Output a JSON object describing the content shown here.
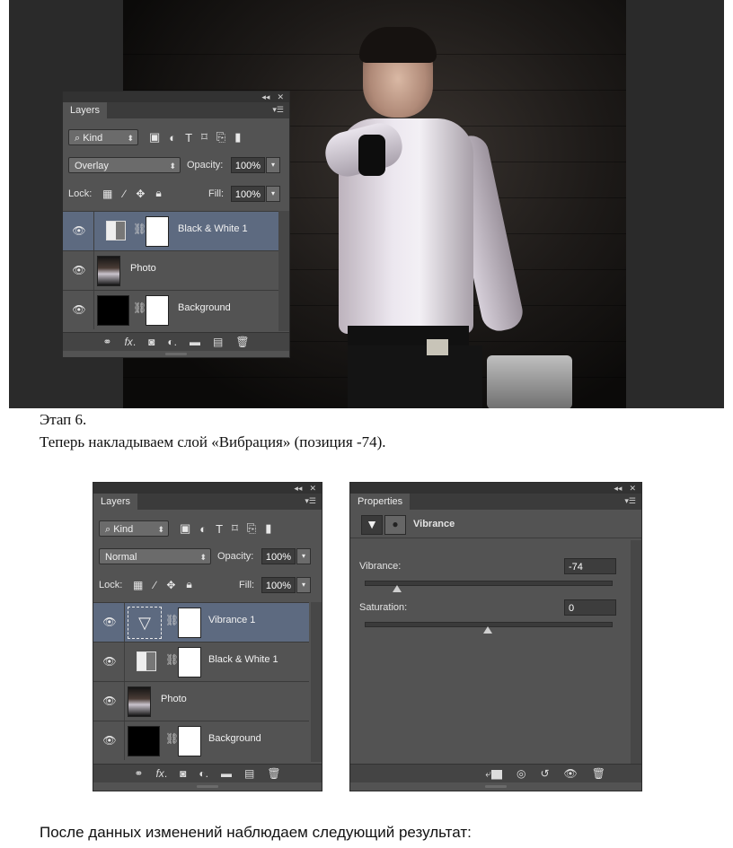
{
  "layers_panel_top": {
    "tab": "Layers",
    "kind_label": "Kind",
    "blend_mode": "Overlay",
    "opacity_label": "Opacity:",
    "opacity_value": "100%",
    "lock_label": "Lock:",
    "fill_label": "Fill:",
    "fill_value": "100%",
    "layers": [
      {
        "name": "Black & White 1",
        "selected": true
      },
      {
        "name": "Photo",
        "selected": false
      },
      {
        "name": "Background",
        "selected": false
      }
    ]
  },
  "caption": {
    "step": "Этап 6.",
    "text": "Теперь накладываем слой «Вибрация» (позиция -74)."
  },
  "layers_panel_bottom": {
    "tab": "Layers",
    "kind_label": "Kind",
    "blend_mode": "Normal",
    "opacity_label": "Opacity:",
    "opacity_value": "100%",
    "lock_label": "Lock:",
    "fill_label": "Fill:",
    "fill_value": "100%",
    "layers": [
      {
        "name": "Vibrance 1",
        "selected": true
      },
      {
        "name": "Black & White 1",
        "selected": false
      },
      {
        "name": "Photo",
        "selected": false
      },
      {
        "name": "Background",
        "selected": false
      }
    ]
  },
  "properties_panel": {
    "tab": "Properties",
    "title": "Vibrance",
    "vibrance_label": "Vibrance:",
    "vibrance_value": "-74",
    "vibrance_fraction": 0.13,
    "saturation_label": "Saturation:",
    "saturation_value": "0",
    "saturation_fraction": 0.5
  },
  "footer_text": "После данных изменений наблюдаем следующий результат:",
  "icons": {
    "panel_bottom": [
      "link-icon",
      "fx-icon",
      "mask-icon",
      "adjustment-icon",
      "folder-icon",
      "new-layer-icon",
      "trash-icon"
    ],
    "properties_bottom": [
      "clip-icon",
      "view-previous-icon",
      "reset-icon",
      "visibility-icon",
      "trash-icon"
    ]
  }
}
